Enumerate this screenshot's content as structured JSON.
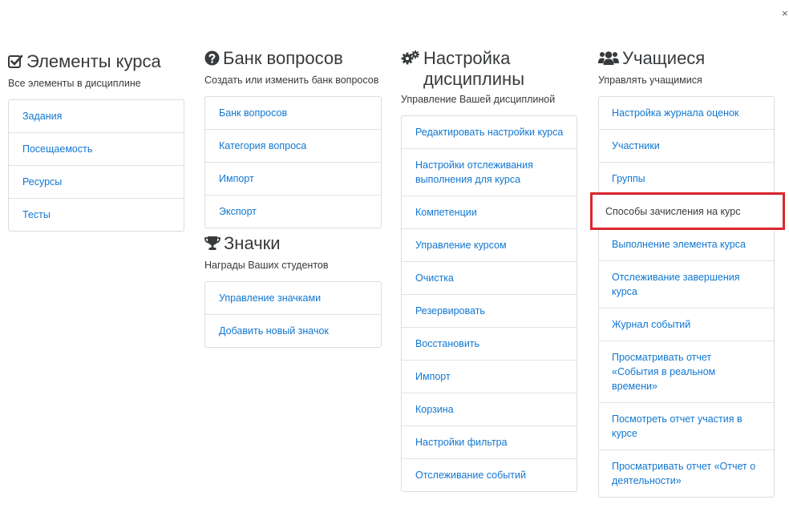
{
  "close_glyph": "×",
  "columns": [
    {
      "icon": "checkbox-icon",
      "title": "Элементы курса",
      "description": "Все элементы в дисциплине",
      "links": [
        "Задания",
        "Посещаемость",
        "Ресурсы",
        "Тесты"
      ]
    },
    {
      "icon": "question-circle-icon",
      "title": "Банк вопросов",
      "description": "Создать или изменить банк вопросов",
      "links": [
        "Банк вопросов",
        "Категория вопроса",
        "Импорт",
        "Экспорт"
      ],
      "subsection": {
        "icon": "trophy-icon",
        "title": "Значки",
        "description": "Награды Ваших студентов",
        "links": [
          "Управление значками",
          "Добавить новый значок"
        ]
      }
    },
    {
      "icon": "cogs-icon",
      "title": "Настройка дисциплины",
      "description": "Управление Вашей дисциплиной",
      "links": [
        "Редактировать настройки курса",
        "Настройки отслеживания выполнения для курса",
        "Компетенции",
        "Управление курсом",
        "Очистка",
        "Резервировать",
        "Восстановить",
        "Импорт",
        "Корзина",
        "Настройки фильтра",
        "Отслеживание событий"
      ]
    },
    {
      "icon": "users-icon",
      "title": "Учащиеся",
      "description": "Управлять учащимися",
      "links": [
        "Настройка журнала оценок",
        "Участники",
        "Группы",
        "Способы зачисления на курс",
        "Выполнение элемента курса",
        "Отслеживание завершения курса",
        "Журнал событий",
        "Просматривать отчет «События в реальном времени»",
        "Посмотреть отчет участия в курсе",
        "Просматривать отчет «Отчет о деятельности»"
      ],
      "highlighted_link": "Способы зачисления на курс"
    }
  ],
  "colors": {
    "link": "#1177d1",
    "text": "#373a3c",
    "highlight_border": "#d9272e"
  }
}
